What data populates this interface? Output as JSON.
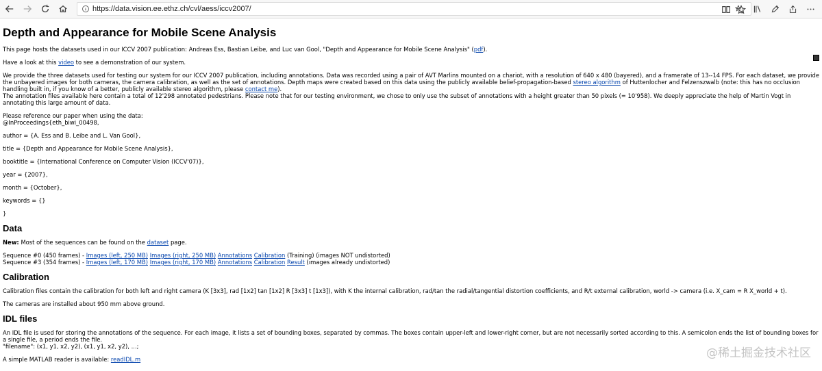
{
  "browser": {
    "url": "https://data.vision.ee.ethz.ch/cvl/aess/iccv2007/"
  },
  "page": {
    "title": "Depth and Appearance for Mobile Scene Analysis",
    "intro_prefix": "This page hosts the datasets used in our ICCV 2007 publication: Andreas Ess, Bastian Leibe, and Luc van Gool, \"Depth and Appearance for Mobile Scene Analysis\" (",
    "intro_pdf_link": "pdf",
    "intro_suffix": ").",
    "video_prefix": "Have a look at this ",
    "video_link": "video",
    "video_suffix": " to see a demonstration of our system.",
    "datasets_p1": "We provide the three datasets used for testing our system for our ICCV 2007 publication, including annotations. Data was recorded using a pair of AVT Marlins mounted on a chariot, with a resolution of 640 x 480 (bayered), and a framerate of 13--14 FPS. For each dataset, we provide the unbayered images for both cameras, the camera calibration, as well as the set of annotations. Depth maps were created based on this data using the publicly available belief-propagation-based ",
    "stereo_link": "stereo algorithm",
    "datasets_p2": " of Huttenlocher and Felzenszwalb (note: this has no occlusion handling built in, if you know of a better, publicly available stereo algorithm, please ",
    "contact_link": "contact me",
    "datasets_p3": ").",
    "annotation_text": "The annotation files available here contain a total of 12'298 annotated pedestrians. Please note that for our testing environment, we chose to only use the subset of annotations with a height greater than 50 pixels (= 10'958). We deeply appreciate the help of Martin Vogt in annotating this large amount of data.",
    "reference_intro": "Please reference our paper when using the data:",
    "bibtex": [
      "@InProceedings{eth_biwi_00498,",
      "author = {A. Ess and B. Leibe and L. Van Gool},",
      "title = {Depth and Appearance for Mobile Scene Analysis},",
      "booktitle = {International Conference on Computer Vision (ICCV'07)},",
      "year = {2007},",
      "month = {October},",
      "keywords = {}",
      "}"
    ]
  },
  "data_section": {
    "heading": "Data",
    "new_label": "New:",
    "new_text": " Most of the sequences can be found on the ",
    "dataset_link": "dataset",
    "new_suffix": " page.",
    "seq0_prefix": "Sequence #0 (450 frames) - ",
    "seq0_left": "Images (left, 250 MB)",
    "seq0_right": "Images (right, 250 MB)",
    "seq0_annotations": "Annotations",
    "seq0_calibration": "Calibration",
    "seq0_suffix": " (Training) (images NOT undistorted)",
    "seq3_prefix": "Sequence #3 (354 frames) - ",
    "seq3_left": "Images (left, 170 MB)",
    "seq3_right": "Images (right, 170 MB)",
    "seq3_annotations": "Annotations",
    "seq3_calibration": "Calibration",
    "seq3_result": "Result",
    "seq3_suffix": " (images already undistorted)"
  },
  "calibration_section": {
    "heading": "Calibration",
    "text1": "Calibration files contain the calibration for both left and right camera (K [3x3], rad [1x2] tan [1x2] R [3x3] t [1x3]), with K the internal calibration, rad/tan the radial/tangential distortion coefficients, and R/t external calibration, world -> camera (i.e. X_cam = R X_world + t).",
    "text2": "The cameras are installed about 950 mm above ground."
  },
  "idl_section": {
    "heading": "IDL files",
    "text1": "An IDL file is used for storing the annotations of the sequence. For each image, it lists a set of bounding boxes, separated by commas. The boxes contain upper-left and lower-right corner, but are not necessarily sorted according to this. A semicolon ends the list of bounding boxes for a single file, a period ends the file.",
    "format": "\"filename\": (x1, y1, x2, y2), (x1, y1, x2, y2), ...;",
    "reader_prefix": "A simple MATLAB reader is available: ",
    "reader_link": "readIDL.m"
  },
  "watermark": "@稀土掘金技术社区"
}
